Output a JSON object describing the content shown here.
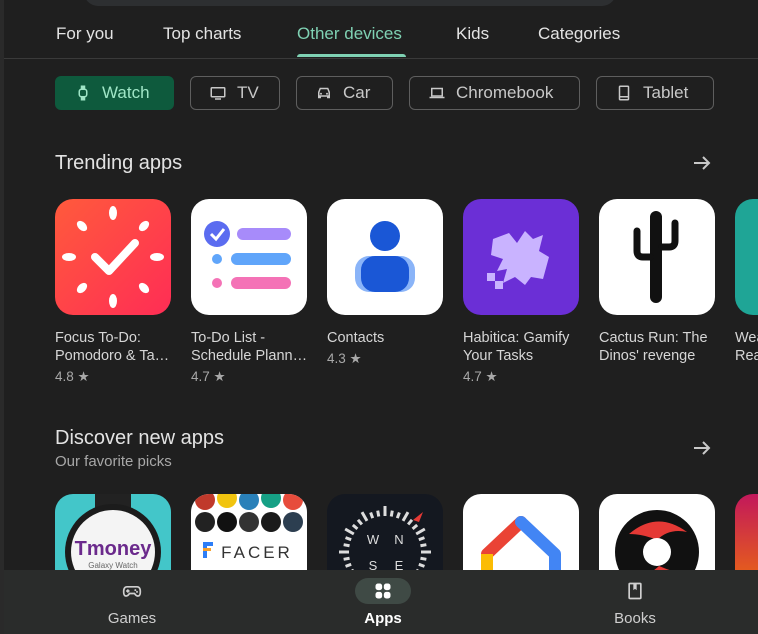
{
  "tabs": [
    {
      "label": "For you"
    },
    {
      "label": "Top charts"
    },
    {
      "label": "Other devices"
    },
    {
      "label": "Kids"
    },
    {
      "label": "Categories"
    }
  ],
  "active_tab": "Other devices",
  "chips": [
    {
      "label": "Watch",
      "icon": "watch-icon"
    },
    {
      "label": "TV",
      "icon": "tv-icon"
    },
    {
      "label": "Car",
      "icon": "car-icon"
    },
    {
      "label": "Chromebook",
      "icon": "laptop-icon"
    },
    {
      "label": "Tablet",
      "icon": "tablet-icon"
    }
  ],
  "trending": {
    "title": "Trending apps",
    "apps": [
      {
        "name1": "Focus To-Do:",
        "name2": "Pomodoro & Ta…",
        "rating": "4.8"
      },
      {
        "name1": "To-Do List -",
        "name2": "Schedule Plann…",
        "rating": "4.7"
      },
      {
        "name1": "Contacts",
        "name2": "",
        "rating": "4.3"
      },
      {
        "name1": "Habitica: Gamify",
        "name2": "Your Tasks",
        "rating": "4.7"
      },
      {
        "name1": "Cactus Run: The",
        "name2": "Dinos' revenge",
        "rating": ""
      },
      {
        "name1": "Wea",
        "name2": "Read",
        "rating": ""
      }
    ]
  },
  "discover": {
    "title": "Discover new apps",
    "subtitle": "Our favorite picks",
    "tmoney_logo": "Tmoney",
    "tmoney_sub": "Galaxy Watch",
    "facer_logo": "FACER",
    "compass_letters": [
      "N",
      "W",
      "E",
      "S"
    ]
  },
  "star": "★",
  "bottom_nav": [
    {
      "label": "Games",
      "icon": "gamepad-icon"
    },
    {
      "label": "Apps",
      "icon": "apps-grid-icon"
    },
    {
      "label": "Books",
      "icon": "bookmark-icon"
    }
  ],
  "colors": {
    "accent": "#7fd1b3",
    "chip_active_bg": "#0e5a3d",
    "background": "#1f1f1f"
  }
}
